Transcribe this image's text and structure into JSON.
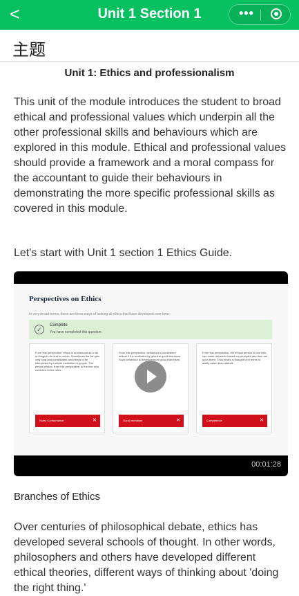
{
  "nav": {
    "back_icon": "chevron-left-icon",
    "title": "Unit 1 Section 1",
    "more": "•••",
    "accent": "#07c160"
  },
  "content": {
    "section_heading": "主题",
    "unit_title": "Unit 1: Ethics and professionalism",
    "intro": "This unit of the module introduces the student to broad ethical and professional values which underpin all the other professional skills and behaviours which are explored in this module. Ethical and professional values should provide a framework and a moral compass for the accountant to guide their behaviours in demonstrating the more specific professional skills as covered in this module.",
    "lead": "Let's start with Unit 1 section 1 Ethics Guide.",
    "video": {
      "slide_title": "Perspectives on Ethics",
      "slide_subtitle": "In very broad terms, there are three ways of looking at ethics that have developed over time:",
      "complete_title": "Complete",
      "complete_text": "You have completed this question.",
      "cards": [
        {
          "text": "From this perspective, ethics is understood as a list of things to do and to not do. Sometimes the list gets very long and complicated and needs to be interpreted by a whole institution of people. The ethical person, from this perspective, is the one who conforms to the rules.",
          "label": "Rules Conformance"
        },
        {
          "text": "From this perspective, behaviour is considered ethical if it is motivated by genuine good intentions. Such behaviour is therefore more good than harm.",
          "label": "Good Intentions"
        },
        {
          "text": "From this perspective, the ethical person is one who can make decisions based on principles and then act upon them. Thus ethics is thought of in terms of ability rather than attitude.",
          "label": "Competence"
        }
      ],
      "duration": "00:01:28"
    },
    "branches_heading": "Branches of Ethics",
    "branches_text": "Over centuries of philosophical debate, ethics has developed several schools of thought. In other words, philosophers and others have developed different ethical theories, different ways of thinking about 'doing the right thing.'"
  }
}
